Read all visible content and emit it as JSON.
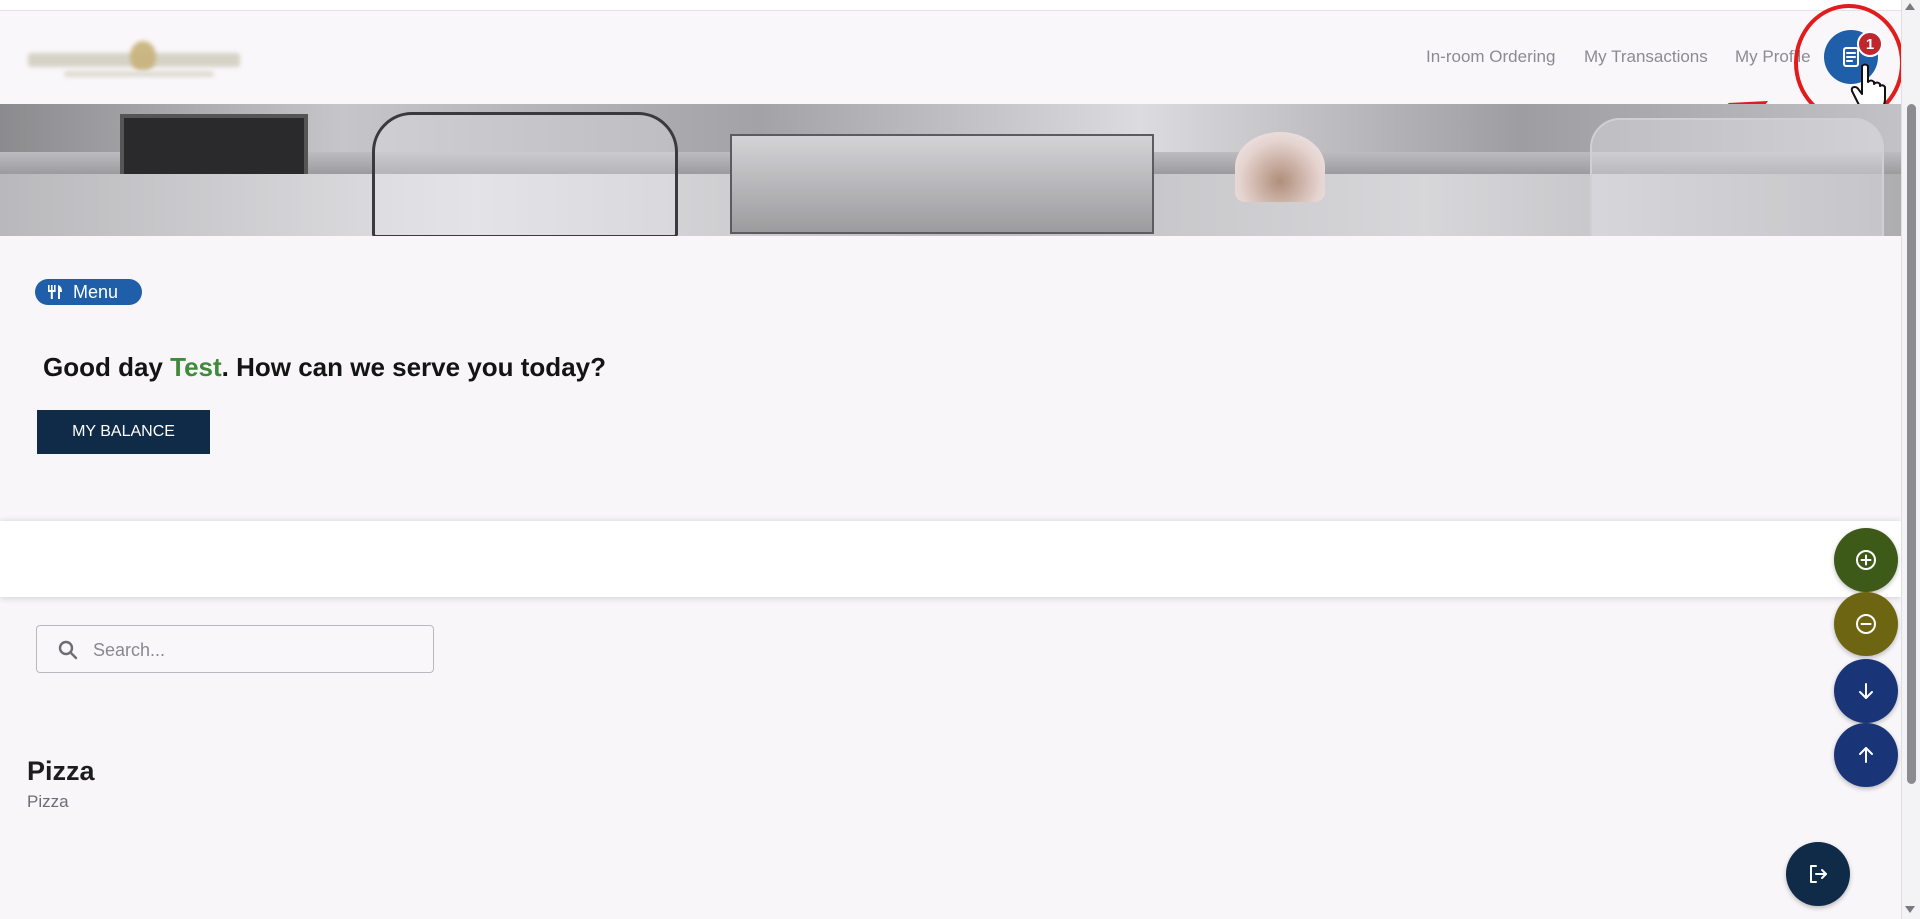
{
  "header": {
    "nav_items": [
      {
        "label": "In-room Ordering"
      },
      {
        "label": "My Transactions"
      },
      {
        "label": "My Profile"
      }
    ],
    "cart_badge_count": "1",
    "cart_icon": "receipt-icon"
  },
  "menu_chip": {
    "label": "Menu",
    "icon": "utensils-icon"
  },
  "greeting": {
    "prefix": "Good day ",
    "name": "Test",
    "suffix": ". How can we serve you today?"
  },
  "balance_button": {
    "label": "MY BALANCE"
  },
  "search": {
    "placeholder": "Search...",
    "value": ""
  },
  "category": {
    "title": "Pizza",
    "subtitle": "Pizza"
  },
  "fabs": {
    "add": {
      "icon": "plus-circle-icon"
    },
    "remove": {
      "icon": "minus-circle-icon"
    },
    "down": {
      "icon": "arrow-down-icon"
    },
    "up": {
      "icon": "arrow-up-icon"
    },
    "exit": {
      "icon": "logout-icon"
    }
  },
  "colors": {
    "primary_blue": "#1f5ea8",
    "navy": "#0f2b48",
    "badge_red": "#c0262e",
    "name_green": "#3f8b3a",
    "fab_green": "#3e5a18",
    "fab_olive": "#6e6512",
    "fab_blue": "#1a3478"
  }
}
